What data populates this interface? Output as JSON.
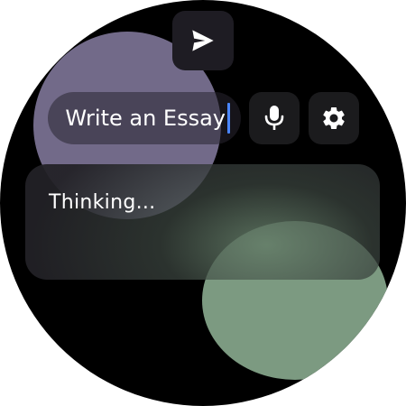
{
  "prompt": {
    "value": "Write an Essay"
  },
  "status": {
    "text": "Thinking..."
  },
  "colors": {
    "background": "#000000",
    "purple_blob": "#726a89",
    "green_blob": "#7c9a81",
    "caret": "#4a86ff",
    "button_bg": "#1b1b1d",
    "text": "#ffffff"
  },
  "icons": {
    "send": "send-icon",
    "mic": "mic-icon",
    "settings": "gear-icon"
  }
}
